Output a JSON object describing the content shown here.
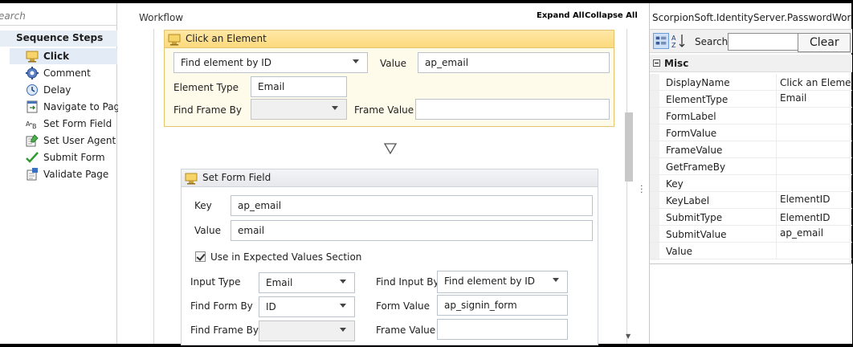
{
  "toolbox": {
    "search_placeholder": "earch",
    "category": "Sequence Steps",
    "items": [
      {
        "label": "Click",
        "icon": "click-activity-icon"
      },
      {
        "label": "Comment",
        "icon": "gear-comment-icon"
      },
      {
        "label": "Delay",
        "icon": "clock-icon"
      },
      {
        "label": "Navigate to Page",
        "icon": "navigate-page-icon"
      },
      {
        "label": "Set Form Field",
        "icon": "form-field-icon"
      },
      {
        "label": "Set User Agent",
        "icon": "user-agent-icon"
      },
      {
        "label": "Submit Form",
        "icon": "checkmark-icon"
      },
      {
        "label": "Validate Page",
        "icon": "validate-page-icon"
      }
    ]
  },
  "designer": {
    "title": "Workflow",
    "expand_all": "Expand All",
    "collapse_all": "Collapse All"
  },
  "click_activity": {
    "title": "Click an Element",
    "find_element_by": "Find element by ID",
    "value_label": "Value",
    "value": "ap_email",
    "element_type_label": "Element Type",
    "element_type": "Email",
    "find_frame_by_label": "Find Frame By",
    "find_frame_by": "",
    "frame_value_label": "Frame Value",
    "frame_value": ""
  },
  "set_form_field": {
    "title": "Set Form Field",
    "key_label": "Key",
    "key": "ap_email",
    "value_label": "Value",
    "value": "email",
    "use_expected_label": "Use in Expected Values Section",
    "use_expected_checked": true,
    "input_type_label": "Input Type",
    "input_type": "Email",
    "find_input_by_label": "Find Input By",
    "find_input_by": "Find element by ID",
    "find_form_by_label": "Find Form By",
    "find_form_by": "ID",
    "form_value_label": "Form Value",
    "form_value": "ap_signin_form",
    "find_frame_by_label": "Find Frame By",
    "find_frame_by": "",
    "frame_value_label": "Frame Value",
    "frame_value": ""
  },
  "properties": {
    "title": "ScorpionSoft.IdentityServer.PasswordWorkfl...",
    "search_label": "Search:",
    "search_value": "",
    "clear_label": "Clear",
    "category": "Misc",
    "rows": [
      {
        "key": "DisplayName",
        "value": "Click an Element"
      },
      {
        "key": "ElementType",
        "value": "Email"
      },
      {
        "key": "FormLabel",
        "value": ""
      },
      {
        "key": "FormValue",
        "value": ""
      },
      {
        "key": "FrameValue",
        "value": ""
      },
      {
        "key": "GetFrameBy",
        "value": ""
      },
      {
        "key": "Key",
        "value": ""
      },
      {
        "key": "KeyLabel",
        "value": "ElementID"
      },
      {
        "key": "SubmitType",
        "value": "ElementID"
      },
      {
        "key": "SubmitValue",
        "value": "ap_email"
      },
      {
        "key": "Value",
        "value": ""
      }
    ]
  },
  "colors": {
    "activity_header": "#fcd97c",
    "activity_border": "#e3c56f",
    "selected_item": "#e3ebf7"
  }
}
